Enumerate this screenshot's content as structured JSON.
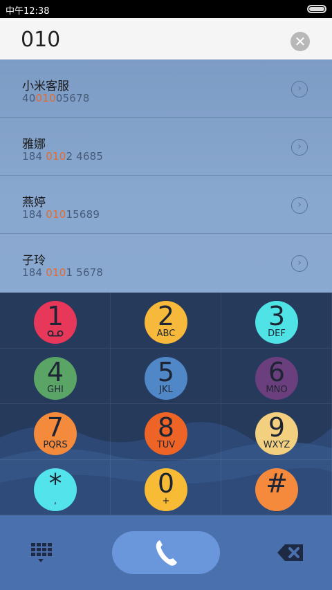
{
  "status": {
    "time": "中午12:38"
  },
  "dialer": {
    "input": "010",
    "clear_label": "✕"
  },
  "results": [
    {
      "name": "小米客服",
      "num_pre": "40",
      "num_hl": "010",
      "num_post": "05678"
    },
    {
      "name": "雅娜",
      "num_pre": "184 ",
      "num_hl": "010",
      "num_post": "2 4685"
    },
    {
      "name": "燕婷",
      "num_pre": "184 ",
      "num_hl": "010",
      "num_post": "15689"
    },
    {
      "name": "子玲",
      "num_pre": "184 ",
      "num_hl": "010",
      "num_post": "1 5678"
    }
  ],
  "keys": [
    {
      "digit": "1",
      "letters": "",
      "color": "#e8385a"
    },
    {
      "digit": "2",
      "letters": "ABC",
      "color": "#f6b93b"
    },
    {
      "digit": "3",
      "letters": "DEF",
      "color": "#4fe3e6"
    },
    {
      "digit": "4",
      "letters": "GHI",
      "color": "#5aa466"
    },
    {
      "digit": "5",
      "letters": "JKL",
      "color": "#4f87c7"
    },
    {
      "digit": "6",
      "letters": "MNO",
      "color": "#6b3f7d"
    },
    {
      "digit": "7",
      "letters": "PQRS",
      "color": "#f48a3c"
    },
    {
      "digit": "8",
      "letters": "TUV",
      "color": "#ee6426"
    },
    {
      "digit": "9",
      "letters": "WXYZ",
      "color": "#f2d07f"
    },
    {
      "digit": "*",
      "letters": ",",
      "color": "#53e3ea"
    },
    {
      "digit": "0",
      "letters": "+",
      "color": "#f7bb36"
    },
    {
      "digit": "#",
      "letters": "",
      "color": "#f5893c"
    }
  ],
  "icons": {
    "voicemail": "voicemail-icon",
    "dialpad": "dialpad-icon",
    "call": "phone-icon",
    "backspace": "backspace-icon",
    "arrow": "chevron-right-icon"
  }
}
